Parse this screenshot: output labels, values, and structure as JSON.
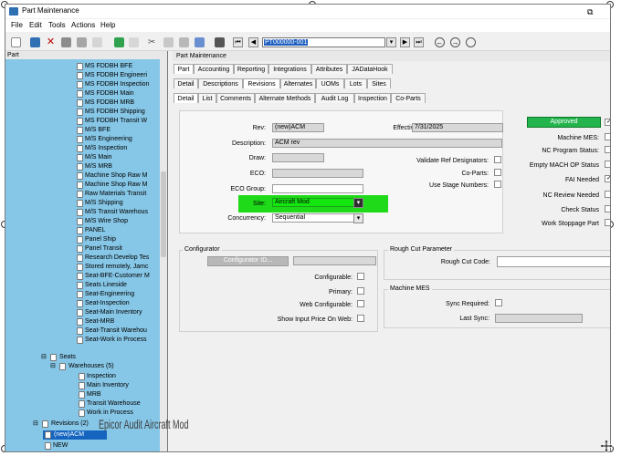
{
  "window": {
    "title": "Part Maintenance"
  },
  "menu": {
    "items": [
      "File",
      "Edit",
      "Tools",
      "Actions",
      "Help"
    ]
  },
  "toolbar": {
    "part_value": "PT000000-001"
  },
  "left_pane": {
    "header": "Part",
    "tree_items": [
      "MS FDDBH BFE",
      "MS FDDBH Engineeri",
      "MS FDDBH Inspection",
      "MS FDDBH Main",
      "MS FDDBH MRB",
      "MS FDDBH Shipping",
      "MS FDDBH Transit W",
      "M/S BFE",
      "M/S Engineering",
      "M/S Inspection",
      "M/S Main",
      "M/S MRB",
      "Machine Shop Raw M",
      "Machine Shop Raw M",
      "Raw Materials Transit",
      "M/S Shipping",
      "M/S Transit Warehous",
      "M/S Wire Shop",
      "PANEL",
      "Panel Ship",
      "Panel Transit",
      "Research Develop Tes",
      "Stored remotely, Jamc",
      "Seat-BFE-Customer M",
      "Seats Lineside",
      "Seat-Engineering",
      "Seat-Inspection",
      "Seat-Main Inventory",
      "Seat-MRB",
      "Seat-Transit Warehou",
      "Seat-Work in Process"
    ],
    "seats_label": "Seats",
    "warehouses_label": "Warehouses (5)",
    "warehouse_items": [
      "Inspection",
      "Main Inventory",
      "MRB",
      "Transit Warehouse",
      "Work in Process"
    ],
    "revisions_label": "Revisions (2)",
    "revision_items": [
      "(new)ACM",
      "NEW"
    ],
    "overlay_text": "Epicor Audit Aircraft Mod"
  },
  "right_pane": {
    "header": "Part Maintenance",
    "top_tabs": [
      "Part",
      "Accounting",
      "Reporting",
      "Integrations",
      "Attributes",
      "JADataHook"
    ],
    "second_tabs": [
      "Detail",
      "Descriptions",
      "Revisions",
      "Alternates",
      "UOMs",
      "Lots",
      "Sites"
    ],
    "third_tabs": [
      "Detail",
      "List",
      "Comments",
      "Alternate Methods",
      "Audit Log",
      "Inspection",
      "Co-Parts"
    ],
    "labels": {
      "rev": "Rev:",
      "effective": "Effective:",
      "description": "Description:",
      "draw": "Draw:",
      "eco": "ECO:",
      "eco_group": "ECO Group:",
      "site": "Site:",
      "concurrency": "Concurrency:",
      "validate_ref": "Validate Ref Designators:",
      "co_parts": "Co-Parts:",
      "use_stage_numbers": "Use Stage Numbers:",
      "machine_mes": "Machine MES:",
      "nc_program_status": "NC Program Status:",
      "empty_mach_op": "Empty MACH OP Status",
      "fai_needed": "FAI Needed",
      "nc_review_needed": "NC Review Needed",
      "check_status": "Check Status",
      "work_stoppage": "Work Stoppage Part",
      "configurator": "Configurator",
      "configurator_id": "Configurator ID...",
      "configurable": "Configurable:",
      "primary": "Primary:",
      "web_configurable": "Web Configurable:",
      "show_input_price": "Show Input Price On Web:",
      "rough_cut_parameter": "Rough Cut Parameter",
      "rough_cut_code": "Rough Cut Code:",
      "machine_mes_group": "Machine MES",
      "sync_required": "Sync Required:",
      "last_sync": "Last Sync:"
    },
    "values": {
      "rev": "(new)ACM",
      "effective": "7/31/2025",
      "description": "ACM rev",
      "site": "Aircraft Mod",
      "concurrency": "Sequential",
      "status_button": "Approved"
    }
  }
}
